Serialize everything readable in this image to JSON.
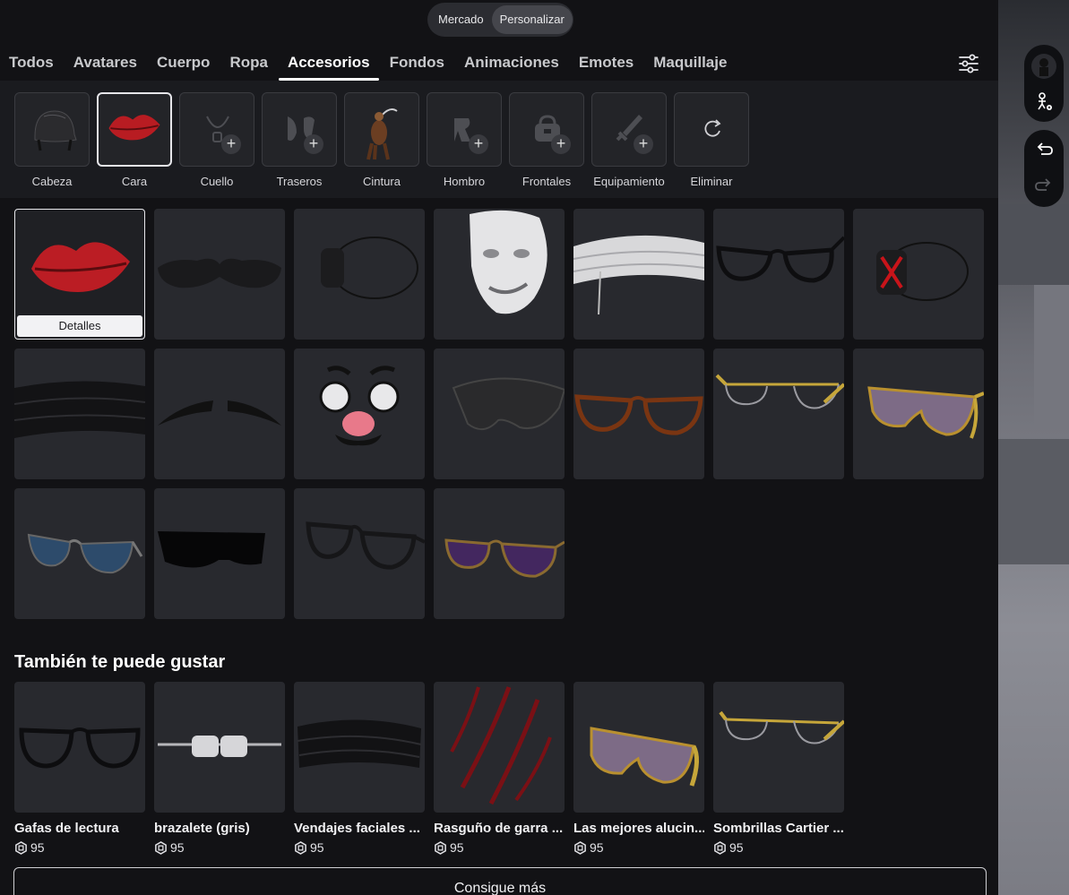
{
  "toggle": {
    "items": [
      {
        "label": "Mercado",
        "active": false
      },
      {
        "label": "Personalizar",
        "active": true
      }
    ]
  },
  "tabs": [
    {
      "label": "Todos",
      "active": false
    },
    {
      "label": "Avatares",
      "active": false
    },
    {
      "label": "Cuerpo",
      "active": false
    },
    {
      "label": "Ropa",
      "active": false
    },
    {
      "label": "Accesorios",
      "active": true
    },
    {
      "label": "Fondos",
      "active": false
    },
    {
      "label": "Animaciones",
      "active": false
    },
    {
      "label": "Emotes",
      "active": false
    },
    {
      "label": "Maquillaje",
      "active": false
    }
  ],
  "slots": [
    {
      "label": "Cabeza",
      "icon": "helmet-icon",
      "filled": true
    },
    {
      "label": "Cara",
      "icon": "lips-icon",
      "filled": true,
      "selected": true
    },
    {
      "label": "Cuello",
      "icon": "necklace-icon",
      "filled": false
    },
    {
      "label": "Traseros",
      "icon": "wings-icon",
      "filled": false
    },
    {
      "label": "Cintura",
      "icon": "waist-figure-icon",
      "filled": true
    },
    {
      "label": "Hombro",
      "icon": "shoulder-icon",
      "filled": false
    },
    {
      "label": "Frontales",
      "icon": "front-bag-icon",
      "filled": false
    },
    {
      "label": "Equipamiento",
      "icon": "sword-icon",
      "filled": false
    },
    {
      "label": "Eliminar",
      "icon": "reset-icon",
      "filled": false
    }
  ],
  "grid": {
    "details_label": "Detalles",
    "items": [
      "lips-icon",
      "mustache-icon",
      "eyepatch-icon",
      "mask-icon",
      "bandage-white-icon",
      "glasses-black-icon",
      "eyepatch-red-icon",
      "bandage-black-icon",
      "brows-icon",
      "novelty-glasses-icon",
      "sunglasses-wrap-icon",
      "glasses-brown-icon",
      "glasses-gold-icon",
      "sunglasses-gold-icon",
      "aviator-blue-icon",
      "visor-black-icon",
      "glasses-thick-icon",
      "aviator-purple-icon"
    ]
  },
  "recommended": {
    "title": "También te puede gustar",
    "items": [
      {
        "name": "Gafas de lectura",
        "price": "95",
        "icon": "glasses-black-icon"
      },
      {
        "name": "brazalete (gris)",
        "price": "95",
        "icon": "bracelet-icon"
      },
      {
        "name": "Vendajes faciales ...",
        "price": "95",
        "icon": "bandage-black-icon"
      },
      {
        "name": "Rasguño de garra ...",
        "price": "95",
        "icon": "claw-scratch-icon"
      },
      {
        "name": "Las mejores alucin...",
        "price": "95",
        "icon": "sunglasses-gold-icon"
      },
      {
        "name": "Sombrillas Cartier ...",
        "price": "95",
        "icon": "glasses-gold-icon"
      }
    ],
    "more_label": "Consigue más"
  },
  "colors": {
    "background": "#121215",
    "card": "#28292e",
    "strip": "#1a1b1f",
    "accent": "#ffffff"
  }
}
